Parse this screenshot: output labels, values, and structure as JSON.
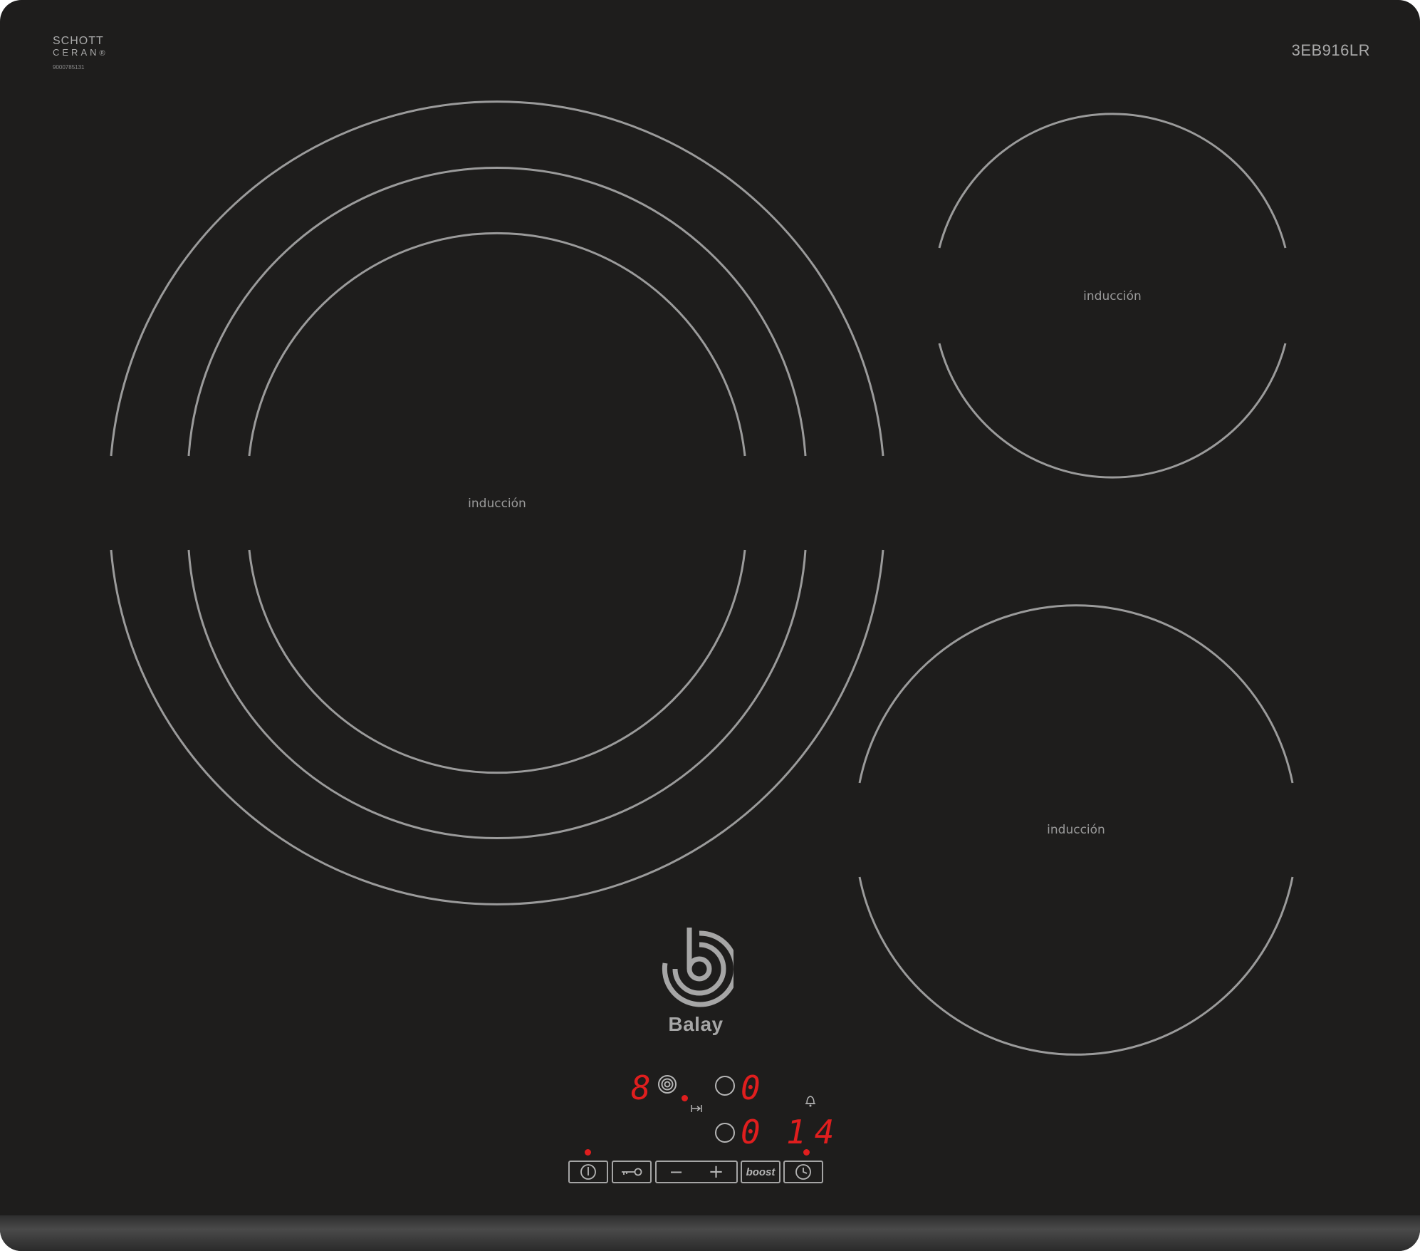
{
  "branding": {
    "glass_brand_line1": "SCHOTT",
    "glass_brand_line2": "CERAN",
    "registered_mark": "®",
    "glass_code": "9000785131",
    "model": "3EB916LR",
    "brand": "Balay"
  },
  "zones": [
    {
      "label": "inducción"
    },
    {
      "label": "inducción"
    },
    {
      "label": "inducción"
    }
  ],
  "display": {
    "left_digit": "8",
    "zone_indicator_top": "0",
    "zone_indicator_bottom": "0",
    "timer": "14"
  },
  "controls": {
    "power_icon": "power-icon",
    "lock_icon": "key-lock-icon",
    "minus": "−",
    "plus": "+",
    "boost": "boost",
    "timer_icon": "clock-icon"
  },
  "colors": {
    "glass": "#1e1d1c",
    "ring": "#9b9b9b",
    "led": "#e01e1e"
  }
}
